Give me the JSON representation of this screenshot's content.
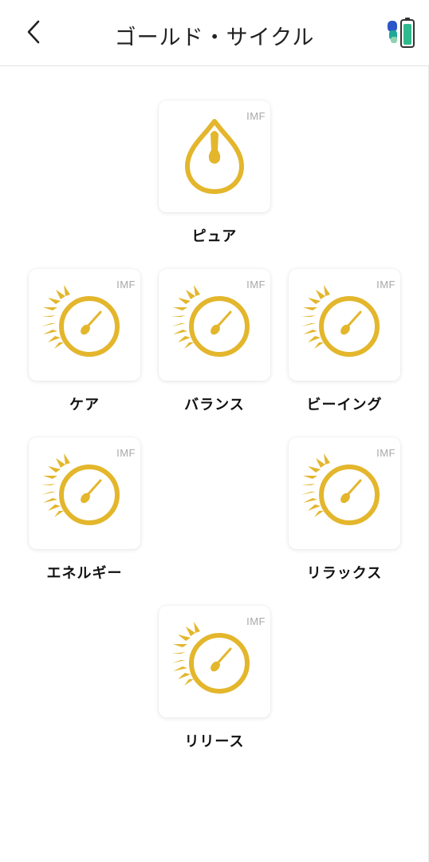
{
  "header": {
    "title": "ゴールド・サイクル",
    "back_icon": "chevron-left-icon",
    "device_icon": "device-battery-icon"
  },
  "colors": {
    "accent_gold": "#e3b62c",
    "battery_green": "#2fb98d",
    "device_blue": "#2c56c8",
    "device_teal": "#1fa89a"
  },
  "tiles": [
    {
      "id": "pure",
      "label": "ピュア",
      "badge": "IMF",
      "icon": "drop-icon"
    },
    {
      "id": "care",
      "label": "ケア",
      "badge": "IMF",
      "icon": "sun-cycle-icon"
    },
    {
      "id": "balance",
      "label": "バランス",
      "badge": "IMF",
      "icon": "sun-cycle-icon"
    },
    {
      "id": "being",
      "label": "ビーイング",
      "badge": "IMF",
      "icon": "sun-cycle-icon"
    },
    {
      "id": "energy",
      "label": "エネルギー",
      "badge": "IMF",
      "icon": "sun-cycle-icon"
    },
    {
      "id": "relax",
      "label": "リラックス",
      "badge": "IMF",
      "icon": "sun-cycle-icon"
    },
    {
      "id": "release",
      "label": "リリース",
      "badge": "IMF",
      "icon": "sun-cycle-icon"
    }
  ]
}
